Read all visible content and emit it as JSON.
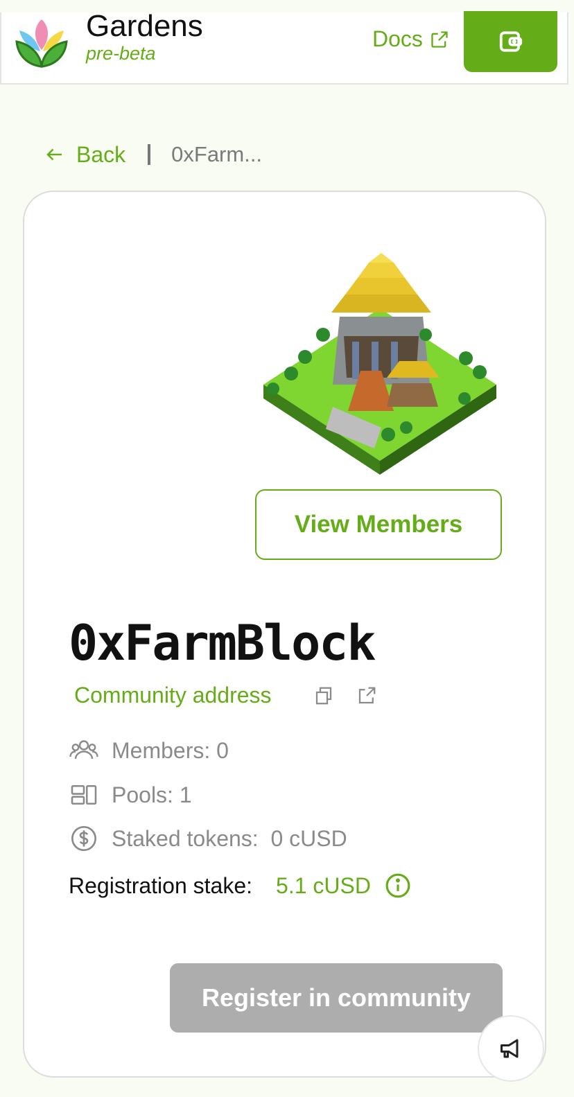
{
  "header": {
    "brand_title": "Gardens",
    "brand_subtitle": "pre-beta",
    "docs_label": "Docs"
  },
  "breadcrumb": {
    "back_label": "Back",
    "current": "0xFarm..."
  },
  "community": {
    "name": "0xFarmBlock",
    "address_label": "Community address",
    "members": "Members: 0",
    "pools": "Pools: 1",
    "staked": "Staked tokens:  0 cUSD",
    "registration_label": "Registration stake:",
    "registration_value": "5.1 cUSD",
    "view_members_label": "View Members",
    "register_label": "Register in community"
  },
  "colors": {
    "accent": "#65ad18",
    "disabled": "#adadad",
    "background": "#f9fcf3"
  },
  "icons": [
    "lotus-logo-icon",
    "external-link-icon",
    "wallet-icon",
    "arrow-left-icon",
    "copy-icon",
    "users-icon",
    "pools-icon",
    "dollar-icon",
    "info-icon",
    "megaphone-icon"
  ]
}
